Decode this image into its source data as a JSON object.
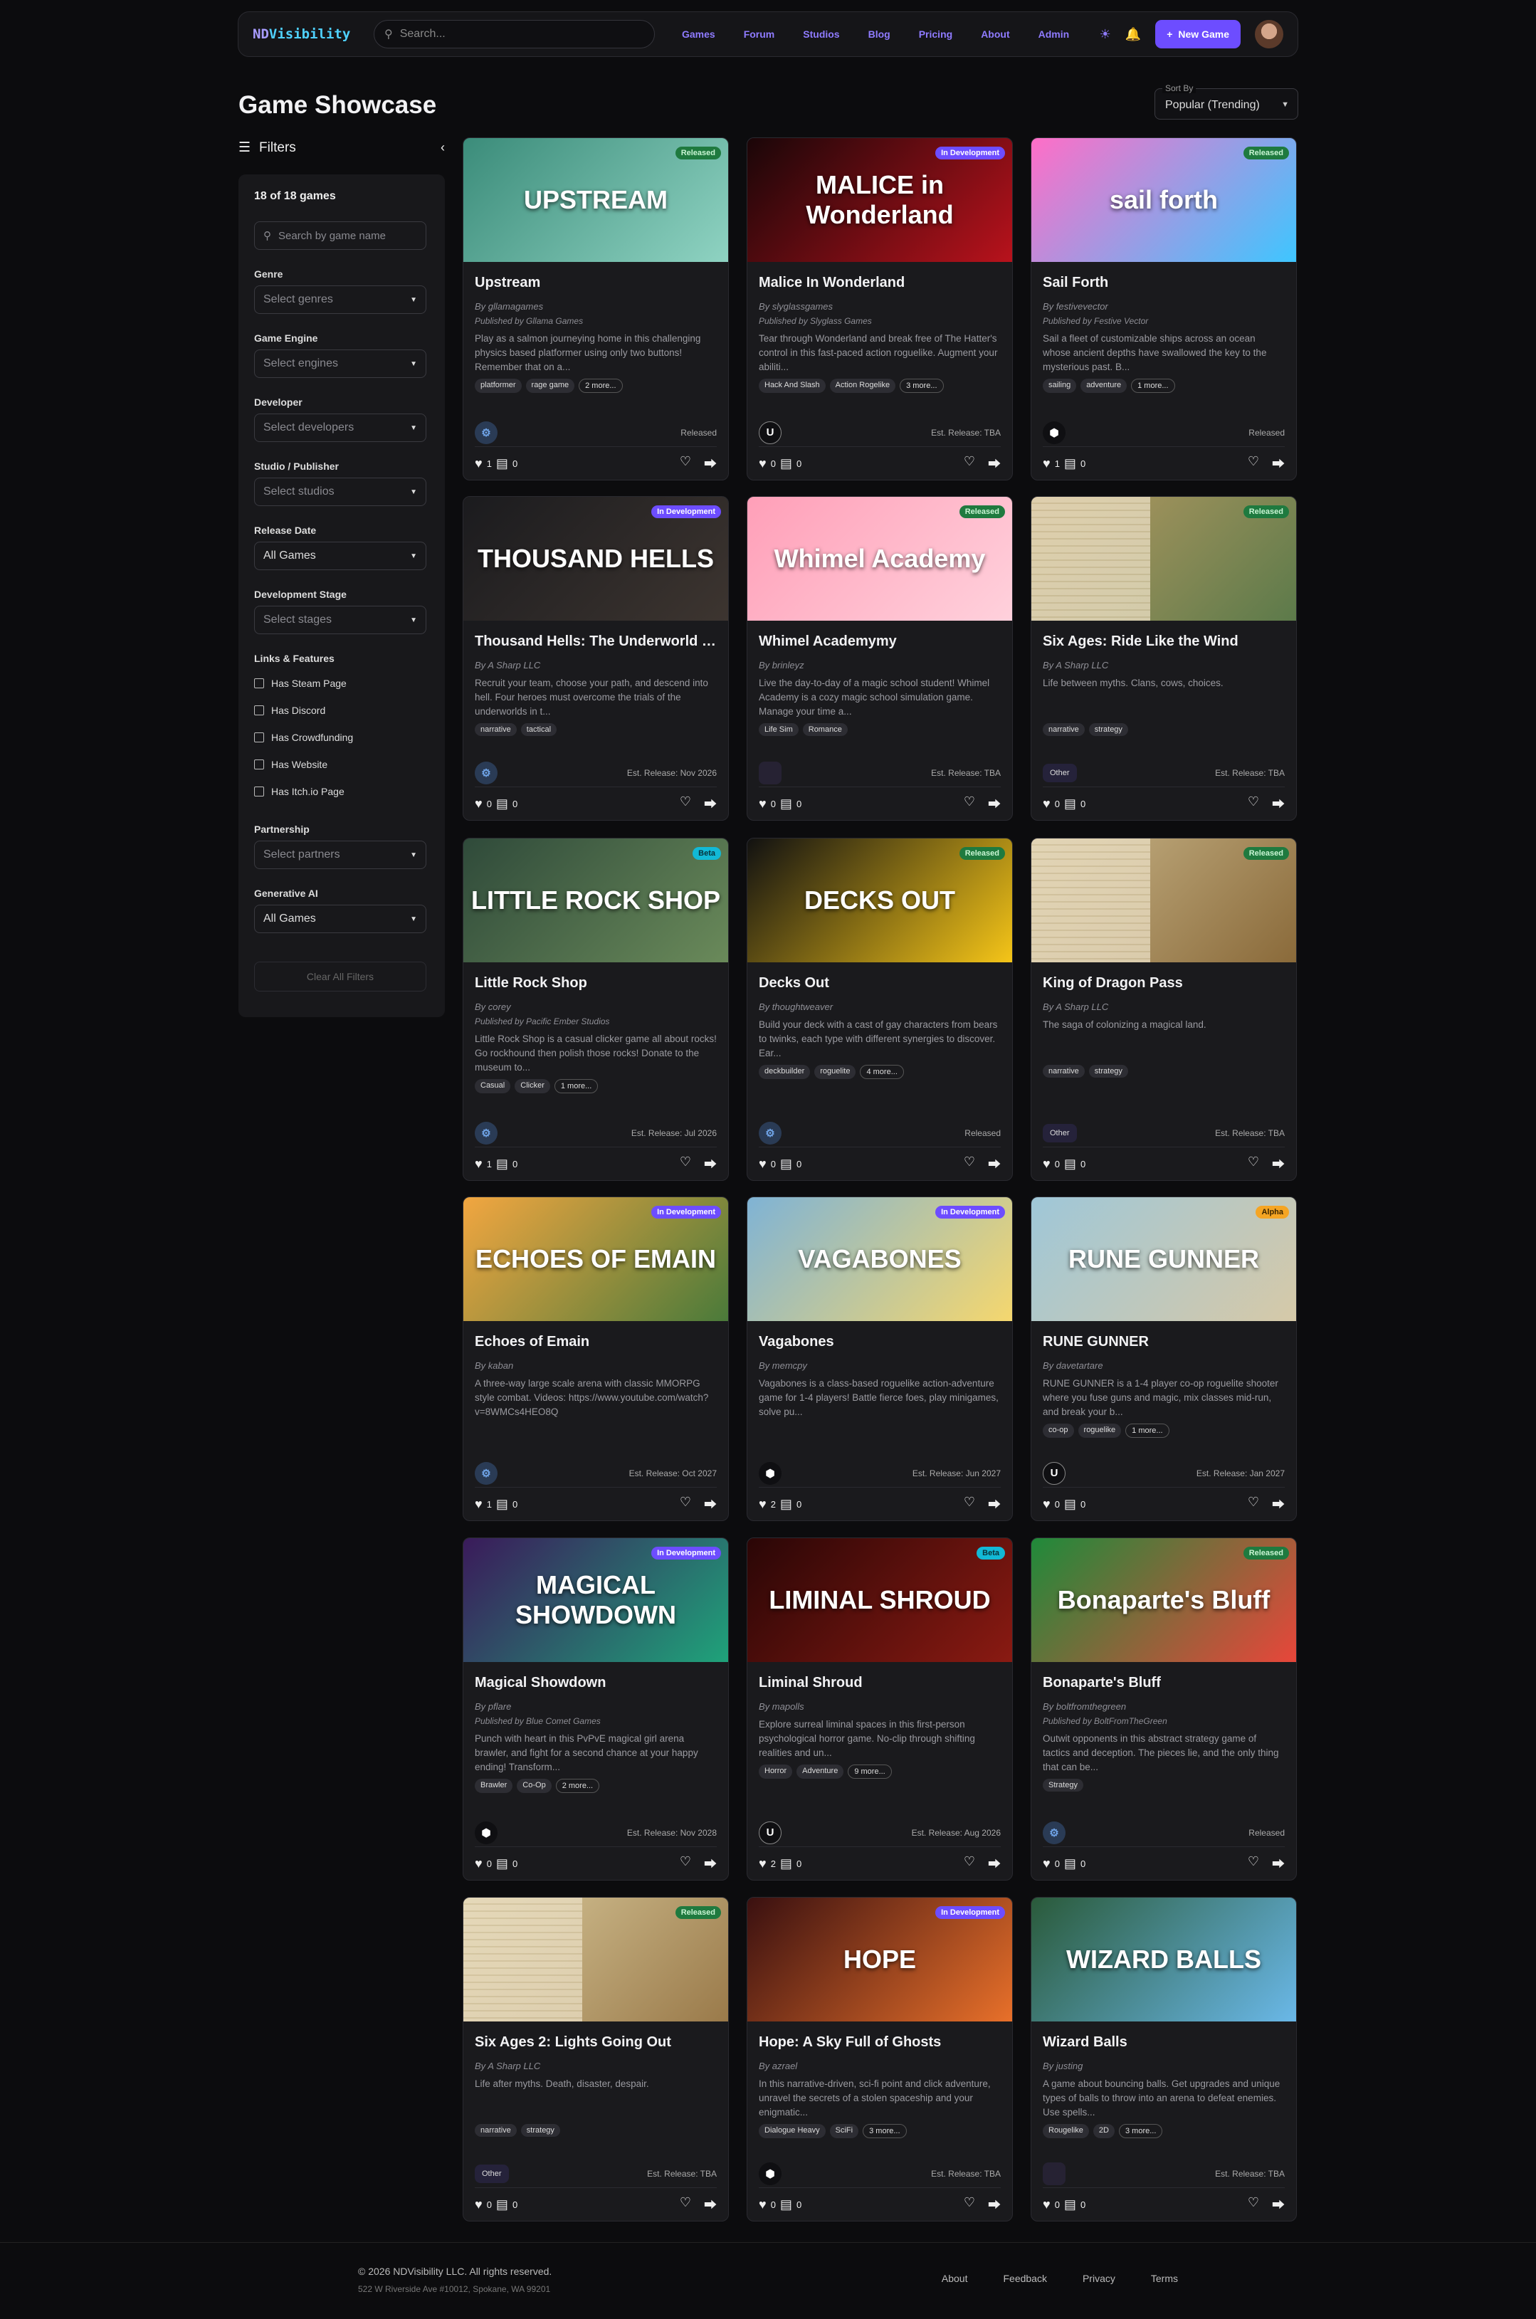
{
  "nav": {
    "logo_a": "ND",
    "logo_b": "Visibility",
    "search_placeholder": "Search...",
    "links": [
      "Games",
      "Forum",
      "Studios",
      "Blog",
      "Pricing",
      "About",
      "Admin"
    ],
    "new_game": "New Game"
  },
  "page": {
    "title": "Game Showcase",
    "sort_label": "Sort By",
    "sort_value": "Popular (Trending)"
  },
  "filters": {
    "heading": "Filters",
    "count": "18 of 18 games",
    "search_placeholder": "Search by game name",
    "groups": [
      {
        "label": "Genre",
        "value": "Select genres"
      },
      {
        "label": "Game Engine",
        "value": "Select engines"
      },
      {
        "label": "Developer",
        "value": "Select developers"
      },
      {
        "label": "Studio / Publisher",
        "value": "Select studios"
      },
      {
        "label": "Release Date",
        "value": "All Games"
      },
      {
        "label": "Development Stage",
        "value": "Select stages"
      }
    ],
    "links_label": "Links & Features",
    "checks": [
      "Has Steam Page",
      "Has Discord",
      "Has Crowdfunding",
      "Has Website",
      "Has Itch.io Page"
    ],
    "partnership_label": "Partnership",
    "partnership_value": "Select partners",
    "ai_label": "Generative AI",
    "ai_value": "All Games",
    "clear": "Clear All Filters"
  },
  "games": [
    {
      "title": "Upstream",
      "badge": "Released",
      "by": "By gllamagames",
      "pub": "Published by Gllama Games",
      "desc": "Play as a salmon journeying home in this challenging physics based platformer using only two buttons! Remember that on a...",
      "tags": [
        "platformer",
        "rage game",
        "2 more..."
      ],
      "engine": "godot",
      "status": "Released",
      "likes": "1",
      "comments": "0",
      "art": "UPSTREAM",
      "colors": [
        "#3b8c7a",
        "#8fd3c2"
      ]
    },
    {
      "title": "Malice In Wonderland",
      "badge": "In Development",
      "by": "By slyglassgames",
      "pub": "Published by Slyglass Games",
      "desc": "Tear through Wonderland and break free of The Hatter's control in this fast-paced action roguelike. Augment your abiliti...",
      "tags": [
        "Hack And Slash",
        "Action Rogelike",
        "3 more..."
      ],
      "engine": "unreal",
      "status": "Est. Release: TBA",
      "likes": "0",
      "comments": "0",
      "art": "MALICE in Wonderland",
      "colors": [
        "#1a0608",
        "#b8121c"
      ]
    },
    {
      "title": "Sail Forth",
      "badge": "Released",
      "by": "By festivevector",
      "pub": "Published by Festive Vector",
      "desc": "Sail a fleet of customizable ships across an ocean whose ancient depths have swallowed the key to the mysterious past. B...",
      "tags": [
        "sailing",
        "adventure",
        "1 more..."
      ],
      "engine": "unity",
      "status": "Released",
      "likes": "1",
      "comments": "0",
      "art": "sail forth",
      "colors": [
        "#ff6ec7",
        "#3ec6ff"
      ]
    },
    {
      "title": "Thousand Hells: The Underworld Heists",
      "badge": "In Development",
      "by": "By A Sharp LLC",
      "pub": "",
      "desc": "Recruit your team, choose your path, and descend into hell. Four heroes must overcome the trials of the underworlds in t...",
      "tags": [
        "narrative",
        "tactical"
      ],
      "engine": "godot",
      "status": "Est. Release: Nov 2026",
      "likes": "0",
      "comments": "0",
      "art": "THOUSAND HELLS",
      "colors": [
        "#1b1b1e",
        "#3d3530"
      ]
    },
    {
      "title": "Whimel Academymy",
      "badge": "Released",
      "by": "By brinleyz",
      "pub": "",
      "desc": "Live the day-to-day of a magic school student! Whimel Academy is a cozy magic school simulation game. Manage your time a...",
      "tags": [
        "Life Sim",
        "Romance"
      ],
      "engine": "empty",
      "status": "Est. Release: TBA",
      "likes": "0",
      "comments": "0",
      "art": "Whimel Academy",
      "colors": [
        "#ff9fb8",
        "#ffd1dc"
      ]
    },
    {
      "title": "Six Ages: Ride Like the Wind",
      "badge": "Released",
      "by": "By A Sharp LLC",
      "pub": "",
      "desc": "Life between myths. Clans, cows, choices.",
      "tags": [
        "narrative",
        "strategy"
      ],
      "engine": "other",
      "status": "Est. Release: TBA",
      "likes": "0",
      "comments": "0",
      "art": "",
      "colors": [
        "#b89a62",
        "#5c7a4a"
      ]
    },
    {
      "title": "Little Rock Shop",
      "badge": "Beta",
      "by": "By corey",
      "pub": "Published by Pacific Ember Studios",
      "desc": "Little Rock Shop is a casual clicker game all about rocks! Go rockhound then polish those rocks! Donate to the museum to...",
      "tags": [
        "Casual",
        "Clicker",
        "1 more..."
      ],
      "engine": "godot",
      "status": "Est. Release: Jul 2026",
      "likes": "1",
      "comments": "0",
      "art": "LITTLE ROCK SHOP",
      "colors": [
        "#2f4a3a",
        "#6a8a5a"
      ]
    },
    {
      "title": "Decks Out",
      "badge": "Released",
      "by": "By thoughtweaver",
      "pub": "",
      "desc": "Build your deck with a cast of gay characters from bears to twinks, each type with different synergies to discover. Ear...",
      "tags": [
        "deckbuilder",
        "roguelite",
        "4 more..."
      ],
      "engine": "godot",
      "status": "Released",
      "likes": "0",
      "comments": "0",
      "art": "DECKS OUT",
      "colors": [
        "#111",
        "#f5c518"
      ]
    },
    {
      "title": "King of Dragon Pass",
      "badge": "Released",
      "by": "By A Sharp LLC",
      "pub": "",
      "desc": "The saga of colonizing a magical land.",
      "tags": [
        "narrative",
        "strategy"
      ],
      "engine": "other",
      "status": "Est. Release: TBA",
      "likes": "0",
      "comments": "0",
      "art": "",
      "colors": [
        "#c9b68a",
        "#8a6a3a"
      ]
    },
    {
      "title": "Echoes of Emain",
      "badge": "In Development",
      "by": "By kaban",
      "pub": "",
      "desc": "A three-way large scale arena with classic MMORPG style combat. Videos: https://www.youtube.com/watch?v=8WMCs4HEO8Q",
      "tags": [],
      "engine": "godot",
      "status": "Est. Release: Oct 2027",
      "likes": "1",
      "comments": "0",
      "art": "ECHOES OF EMAIN",
      "colors": [
        "#f2a640",
        "#4a7a3a"
      ]
    },
    {
      "title": "Vagabones",
      "badge": "In Development",
      "by": "By memcpy",
      "pub": "",
      "desc": "Vagabones is a class-based roguelike action-adventure game for 1-4 players! Battle fierce foes, play minigames, solve pu...",
      "tags": [],
      "engine": "unity",
      "status": "Est. Release: Jun 2027",
      "likes": "2",
      "comments": "0",
      "art": "VAGABONES",
      "colors": [
        "#7fb3d5",
        "#f5d76e"
      ]
    },
    {
      "title": "RUNE GUNNER",
      "badge": "Alpha",
      "by": "By davetartare",
      "pub": "",
      "desc": "RUNE GUNNER is a 1-4 player co-op roguelite shooter where you fuse guns and magic, mix classes mid-run, and break your b...",
      "tags": [
        "co-op",
        "roguelike",
        "1 more..."
      ],
      "engine": "unreal",
      "status": "Est. Release: Jan 2027",
      "likes": "0",
      "comments": "0",
      "art": "RUNE GUNNER",
      "colors": [
        "#9fc7d8",
        "#d6c9a8"
      ]
    },
    {
      "title": "Magical Showdown",
      "badge": "In Development",
      "by": "By pflare",
      "pub": "Published by Blue Comet Games",
      "desc": "Punch with heart in this PvPvE magical girl arena brawler, and fight for a second chance at your happy ending! Transform...",
      "tags": [
        "Brawler",
        "Co-Op",
        "2 more..."
      ],
      "engine": "unity",
      "status": "Est. Release: Nov 2028",
      "likes": "0",
      "comments": "0",
      "art": "MAGICAL SHOWDOWN",
      "colors": [
        "#3a1a5a",
        "#1fa37a"
      ]
    },
    {
      "title": "Liminal Shroud",
      "badge": "Beta",
      "by": "By mapolls",
      "pub": "",
      "desc": "Explore surreal liminal spaces in this first-person psychological horror game. No-clip through shifting realities and un...",
      "tags": [
        "Horror",
        "Adventure",
        "9 more..."
      ],
      "engine": "unreal",
      "status": "Est. Release: Aug 2026",
      "likes": "2",
      "comments": "0",
      "art": "LIMINAL SHROUD",
      "colors": [
        "#2a0606",
        "#8a1a12"
      ]
    },
    {
      "title": "Bonaparte's Bluff",
      "badge": "Released",
      "by": "By boltfromthegreen",
      "pub": "Published by BoltFromTheGreen",
      "desc": "Outwit opponents in this abstract strategy game of tactics and deception. The pieces lie, and the only thing that can be...",
      "tags": [
        "Strategy"
      ],
      "engine": "godot",
      "status": "Released",
      "likes": "0",
      "comments": "0",
      "art": "Bonaparte's Bluff",
      "colors": [
        "#1f8a3a",
        "#e8463a"
      ]
    },
    {
      "title": "Six Ages 2: Lights Going Out",
      "badge": "Released",
      "by": "By A Sharp LLC",
      "pub": "",
      "desc": "Life after myths. Death, disaster, despair.",
      "tags": [
        "narrative",
        "strategy"
      ],
      "engine": "other",
      "status": "Est. Release: TBA",
      "likes": "0",
      "comments": "0",
      "art": "",
      "colors": [
        "#d8c89a",
        "#9a7a4a"
      ]
    },
    {
      "title": "Hope: A Sky Full of Ghosts",
      "badge": "In Development",
      "by": "By azrael",
      "pub": "",
      "desc": "In this narrative-driven, sci-fi point and click adventure, unravel the secrets of a stolen spaceship and your enigmatic...",
      "tags": [
        "Dialogue Heavy",
        "SciFi",
        "3 more..."
      ],
      "engine": "unity",
      "status": "Est. Release: TBA",
      "likes": "0",
      "comments": "0",
      "art": "HOPE",
      "colors": [
        "#3a1010",
        "#e8702a"
      ]
    },
    {
      "title": "Wizard Balls",
      "badge": "",
      "by": "By justing",
      "pub": "",
      "desc": "A game about bouncing balls. Get upgrades and unique types of balls to throw into an arena to defeat enemies. Use spells...",
      "tags": [
        "Rougelike",
        "2D",
        "3 more..."
      ],
      "engine": "empty",
      "status": "Est. Release: TBA",
      "likes": "0",
      "comments": "0",
      "art": "WIZARD BALLS",
      "colors": [
        "#2a5a3a",
        "#6ab8e8"
      ]
    }
  ],
  "footer": {
    "copy": "© 2026 NDVisibility LLC. All rights reserved.",
    "addr": "522 W Riverside Ave #10012, Spokane, WA 99201",
    "links": [
      "About",
      "Feedback",
      "Privacy",
      "Terms"
    ]
  }
}
